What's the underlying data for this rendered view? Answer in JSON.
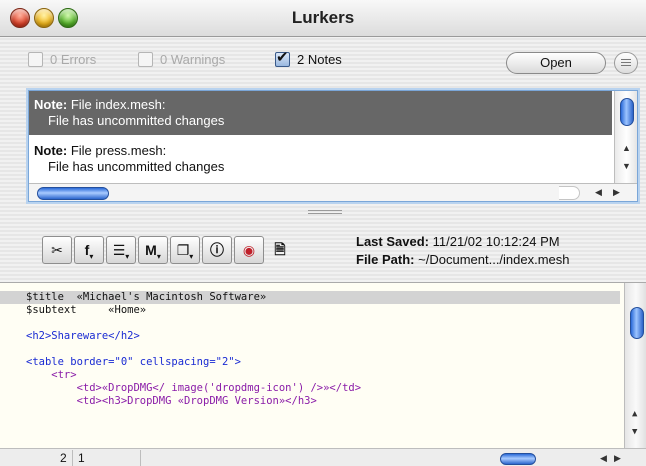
{
  "window": {
    "title": "Lurkers"
  },
  "filters": {
    "errors": {
      "label": "0 Errors",
      "checked": false
    },
    "warnings": {
      "label": "0 Warnings",
      "checked": false
    },
    "notes": {
      "label": "2 Notes",
      "checked": true
    },
    "open_label": "Open"
  },
  "messages": [
    {
      "kind": "Note:",
      "title": " File index.mesh:",
      "detail": "File has uncommitted changes",
      "selected": true
    },
    {
      "kind": "Note:",
      "title": " File press.mesh:",
      "detail": "File has uncommitted changes",
      "selected": false
    }
  ],
  "toolbar": {
    "buttons": [
      "tools-icon",
      "function-icon",
      "list-icon",
      "mark-icon",
      "document-icon",
      "info-icon",
      "status-icon",
      "page-icon"
    ],
    "last_saved_label": "Last Saved:",
    "last_saved_value": "11/21/02 10:12:24 PM",
    "file_path_label": "File Path:",
    "file_path_value": "~/Document.../index.mesh"
  },
  "editor": {
    "lines": [
      "$title  «Michael's Macintosh Software»",
      "$subtext     «Home»",
      "",
      "<h2>Shareware</h2>",
      "",
      "<table border=\"0\" cellspacing=\"2\">",
      "    <tr>",
      "        <td>«DropDMG</ image('dropdmg-icon') />»</td>",
      "        <td><h3>DropDMG «DropDMG Version»</h3>"
    ],
    "line_number": "2",
    "column_number": "1"
  }
}
